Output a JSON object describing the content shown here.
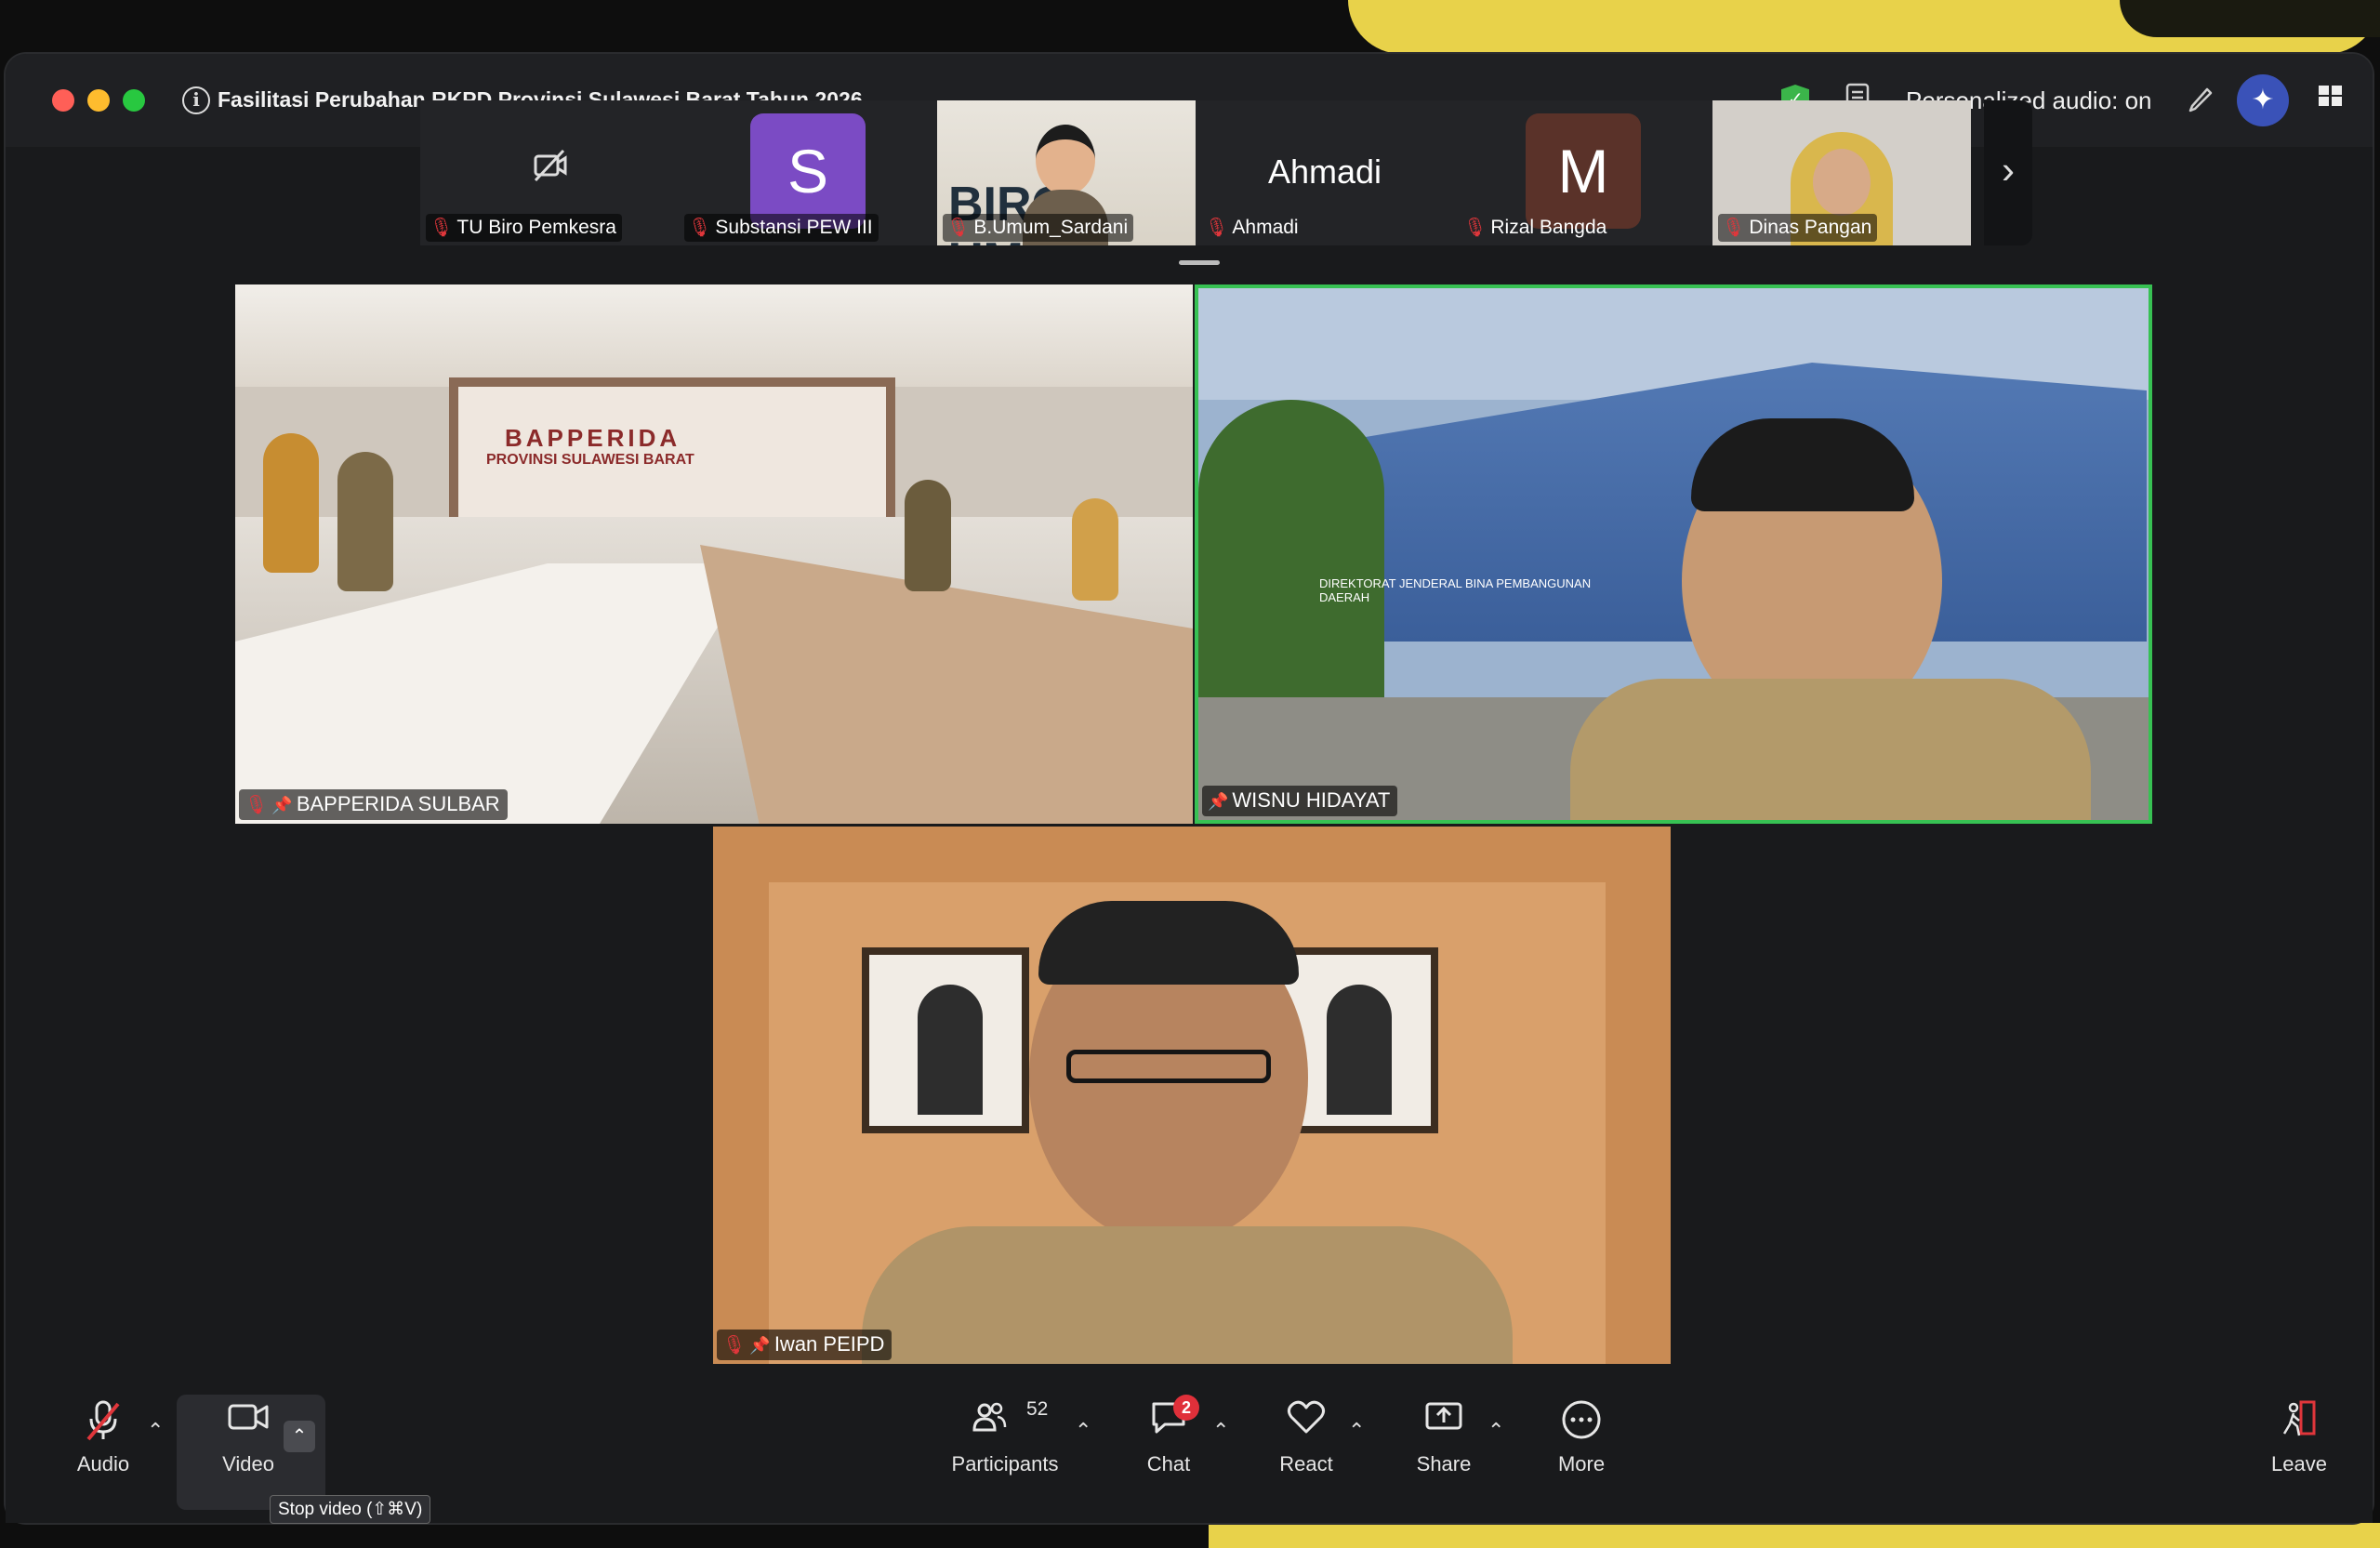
{
  "window": {
    "title": "Fasilitasi Perubahan RKPD Provinsi Sulawesi Barat Tahun 2026",
    "audio_status": "Personalized audio: on",
    "traffic_colors": [
      "#ff5f57",
      "#febc2e",
      "#28c840"
    ]
  },
  "filmstrip": [
    {
      "name": "TU Biro Pemkesra",
      "type": "video-off",
      "muted": true
    },
    {
      "name": "Substansi PEW III",
      "type": "avatar",
      "letter": "S",
      "color": "#7b4bc4",
      "muted": true
    },
    {
      "name": "B.Umum_Sardani",
      "type": "video",
      "muted": true
    },
    {
      "name": "Ahmadi",
      "type": "name",
      "display": "Ahmadi",
      "muted": true
    },
    {
      "name": "Rizal Bangda",
      "type": "avatar",
      "letter": "M",
      "color": "#5a3229",
      "muted": true
    },
    {
      "name": "Dinas Pangan",
      "type": "video",
      "muted": true
    }
  ],
  "videos": [
    {
      "name": "BAPPERIDA SULBAR",
      "muted": true,
      "pinned": true
    },
    {
      "name": "WISNU HIDAYAT",
      "muted": false,
      "pinned": true,
      "active_speaker": true
    },
    {
      "name": "Iwan PEIPD",
      "muted": true,
      "pinned": true
    }
  ],
  "toolbar": {
    "audio": "Audio",
    "video": "Video",
    "participants": "Participants",
    "participants_count": "52",
    "chat": "Chat",
    "chat_badge": "2",
    "react": "React",
    "share": "Share",
    "more": "More",
    "leave": "Leave",
    "tooltip": "Stop video (⇧⌘V)"
  },
  "icons": {
    "info": "info-icon",
    "encryption": "shield-check-icon",
    "notes": "notes-icon",
    "annotate": "pencil-icon",
    "ai": "sparkle-icon",
    "view": "grid-view-icon"
  }
}
